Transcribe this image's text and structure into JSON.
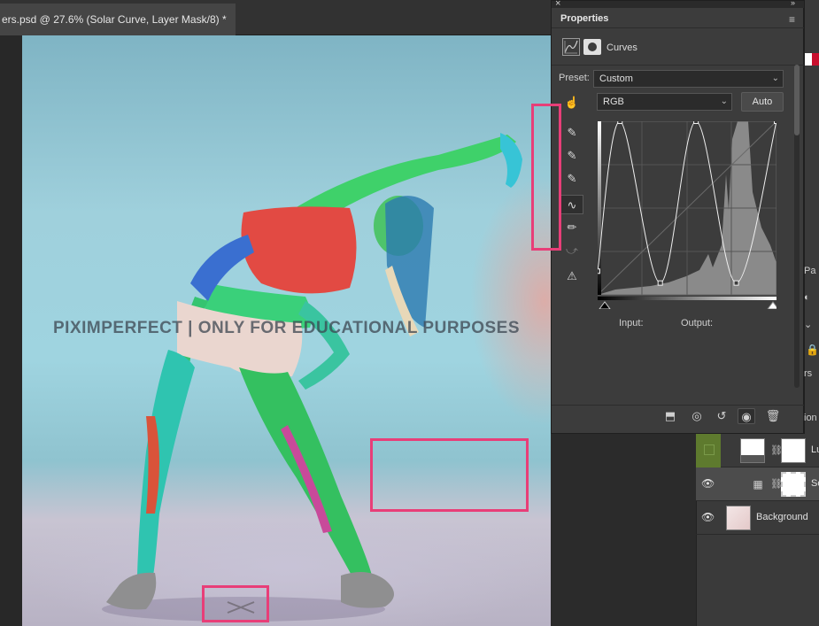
{
  "document": {
    "tab_title": "ers.psd @ 27.6% (Solar Curve, Layer Mask/8) *",
    "close_glyph": "×"
  },
  "canvas": {
    "watermark": "PIXIMPERFECT | ONLY FOR EDUCATIONAL PURPOSES"
  },
  "properties": {
    "title": "Properties",
    "panel_type": "Curves",
    "preset_label": "Preset:",
    "preset_value": "Custom",
    "channel_value": "RGB",
    "auto_label": "Auto",
    "input_label": "Input:",
    "output_label": "Output:",
    "tools": [
      "on-image-adjust-icon",
      "black-point-eyedropper-icon",
      "gray-point-eyedropper-icon",
      "white-point-eyedropper-icon",
      "curve-point-tool-icon",
      "pencil-draw-icon",
      "smooth-curve-icon",
      "clipping-warning-icon"
    ],
    "bottom_icons": [
      "clip-to-layer-icon",
      "view-previous-state-icon",
      "reset-icon",
      "visibility-eye-icon",
      "delete-icon"
    ],
    "curve": {
      "points": [
        [
          0,
          30
        ],
        [
          25,
          220
        ],
        [
          70,
          15
        ],
        [
          110,
          220
        ],
        [
          155,
          15
        ],
        [
          200,
          220
        ]
      ],
      "ranges": {
        "input": [
          0,
          255
        ],
        "output": [
          0,
          255
        ]
      }
    }
  },
  "layers": {
    "rows": [
      {
        "name": "Lu",
        "visible": false,
        "type": "adjustment"
      },
      {
        "name": "So",
        "visible": true,
        "type": "curves",
        "selected": true
      },
      {
        "name": "Background",
        "visible": true,
        "type": "background"
      }
    ]
  },
  "right_panel": {
    "tabs": [
      "Pa",
      "rs",
      "ion"
    ]
  },
  "colors": {
    "highlight": "#e83e78",
    "panel_bg": "#3c3c3c",
    "accent_green": "#5e7a2e"
  }
}
